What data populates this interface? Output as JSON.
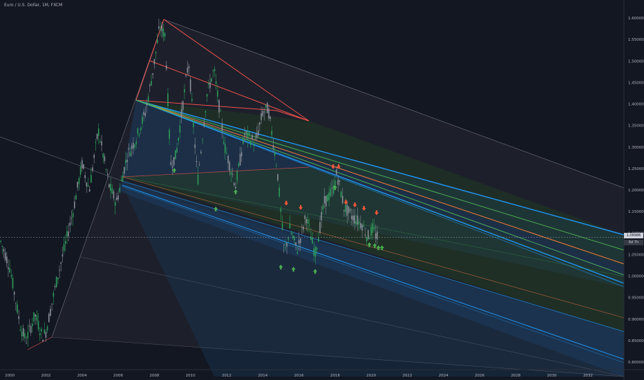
{
  "header": {
    "title": "Euro / U.S. Dollar, 1M, FXCM"
  },
  "price_badge": {
    "value": "1.08986",
    "countdown": "6d 7h"
  },
  "colors": {
    "background": "#131722",
    "axis_text": "#b2b5be",
    "candle": "#8a8f99",
    "candle_up": "#2e9c5a",
    "pitchfork_red": "#f0504a",
    "median_orange": "#ff7a45",
    "line_green": "#4caf50",
    "line_blue": "#2196f3",
    "zone_blue": "#1b3c5e",
    "zone_green": "#223d22",
    "zone_grey": "#2a2d38",
    "channel_outline": "#8a8d96",
    "arrow_up": "#4caf50",
    "arrow_down": "#f4563b"
  },
  "chart_data": {
    "type": "candlestick",
    "symbol": "Euro / U.S. Dollar",
    "interval": "1M",
    "source": "FXCM",
    "x_tick_labels": [
      "2000",
      "2002",
      "2004",
      "2006",
      "2008",
      "2010",
      "2012",
      "2014",
      "2016",
      "2018",
      "2020",
      "2022",
      "2024",
      "2026",
      "2028",
      "2030",
      "2032"
    ],
    "y_tick_labels": [
      "1.60000",
      "1.55000",
      "1.50000",
      "1.45000",
      "1.40000",
      "1.35000",
      "1.30000",
      "1.25000",
      "1.20000",
      "1.15000",
      "1.10000",
      "1.05000",
      "1.00000",
      "0.95000",
      "0.90000",
      "0.85000",
      "0.80000"
    ],
    "ylim": [
      0.78,
      1.63
    ],
    "xlim": [
      1999.0,
      2034.0
    ],
    "last_price": 1.08986,
    "price_path": [
      [
        1999.5,
        1.08
      ],
      [
        2000.0,
        1.02
      ],
      [
        2000.6,
        0.88
      ],
      [
        2000.9,
        0.85
      ],
      [
        2001.4,
        0.91
      ],
      [
        2001.8,
        0.86
      ],
      [
        2002.0,
        0.87
      ],
      [
        2002.6,
        0.99
      ],
      [
        2003.0,
        1.06
      ],
      [
        2003.5,
        1.15
      ],
      [
        2004.0,
        1.26
      ],
      [
        2004.4,
        1.2
      ],
      [
        2004.9,
        1.34
      ],
      [
        2005.5,
        1.21
      ],
      [
        2005.9,
        1.17
      ],
      [
        2006.5,
        1.28
      ],
      [
        2007.0,
        1.32
      ],
      [
        2007.5,
        1.38
      ],
      [
        2007.9,
        1.47
      ],
      [
        2008.3,
        1.58
      ],
      [
        2008.6,
        1.56
      ],
      [
        2008.9,
        1.26
      ],
      [
        2009.2,
        1.28
      ],
      [
        2009.9,
        1.5
      ],
      [
        2010.4,
        1.22
      ],
      [
        2010.9,
        1.42
      ],
      [
        2011.3,
        1.48
      ],
      [
        2011.9,
        1.3
      ],
      [
        2012.5,
        1.21
      ],
      [
        2013.0,
        1.33
      ],
      [
        2013.6,
        1.31
      ],
      [
        2014.0,
        1.38
      ],
      [
        2014.3,
        1.39
      ],
      [
        2014.8,
        1.25
      ],
      [
        2015.2,
        1.05
      ],
      [
        2015.5,
        1.11
      ],
      [
        2015.9,
        1.06
      ],
      [
        2016.4,
        1.14
      ],
      [
        2016.9,
        1.05
      ],
      [
        2017.4,
        1.17
      ],
      [
        2017.9,
        1.2
      ],
      [
        2018.1,
        1.24
      ],
      [
        2018.5,
        1.16
      ],
      [
        2018.9,
        1.14
      ],
      [
        2019.5,
        1.12
      ],
      [
        2019.8,
        1.09
      ],
      [
        2020.1,
        1.11
      ],
      [
        2020.3,
        1.09
      ]
    ],
    "arrows_up": [
      [
        2009.1,
        1.245
      ],
      [
        2011.4,
        1.155
      ],
      [
        2012.5,
        1.195
      ],
      [
        2015.0,
        1.02
      ],
      [
        2015.7,
        1.015
      ],
      [
        2016.9,
        1.01
      ],
      [
        2018.0,
        1.205
      ],
      [
        2019.9,
        1.072
      ],
      [
        2020.2,
        1.07
      ],
      [
        2020.4,
        1.065
      ],
      [
        2020.6,
        1.065
      ]
    ],
    "arrows_down": [
      [
        2015.3,
        1.17
      ],
      [
        2016.1,
        1.16
      ],
      [
        2017.9,
        1.255
      ],
      [
        2018.2,
        1.255
      ],
      [
        2018.6,
        1.172
      ],
      [
        2019.1,
        1.166
      ],
      [
        2019.6,
        1.158
      ],
      [
        2020.3,
        1.148
      ]
    ],
    "median_line_fan": {
      "pivots": [
        [
          2002.0,
          0.85
        ],
        [
          2008.3,
          1.6
        ],
        [
          2016.4,
          1.225
        ]
      ],
      "inner_levels": [
        [
          2006.9,
          1.41
        ],
        [
          2014.3,
          1.38
        ]
      ]
    }
  }
}
